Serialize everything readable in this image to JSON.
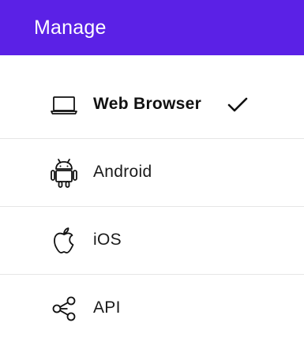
{
  "header": {
    "title": "Manage",
    "background_color": "#5b21e6"
  },
  "menu": {
    "items": [
      {
        "label": "Web Browser",
        "icon": "laptop-icon",
        "selected": true
      },
      {
        "label": "Android",
        "icon": "android-icon",
        "selected": false
      },
      {
        "label": "iOS",
        "icon": "apple-icon",
        "selected": false
      },
      {
        "label": "API",
        "icon": "share-nodes-icon",
        "selected": false
      }
    ],
    "selected_indicator_icon": "checkmark-icon"
  }
}
